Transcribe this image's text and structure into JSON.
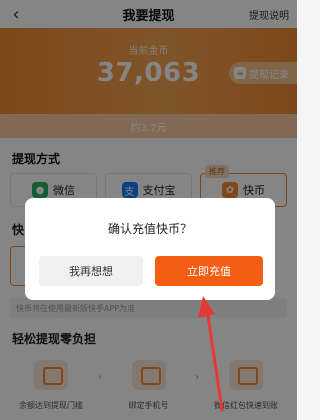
{
  "header": {
    "title": "我要提现",
    "right_link": "提现说明"
  },
  "banner": {
    "label": "当前金币",
    "amount": "37,063",
    "record_button": "提现记录",
    "approx": "约3.7元"
  },
  "methods": {
    "title": "提现方式",
    "items": [
      {
        "label": "微信",
        "icon": "wechat-icon"
      },
      {
        "label": "支付宝",
        "icon": "alipay-icon"
      },
      {
        "label": "快币",
        "icon": "kuaibi-icon",
        "tag": "推荐"
      }
    ]
  },
  "kuaibi_section": {
    "title_visible": "快"
  },
  "note": "快币将在使用最新版快手APP为准",
  "easy": {
    "title": "轻松提现零负担",
    "steps": [
      "余额达到提现门槛",
      "绑定手机号",
      "微信红包快速到账"
    ]
  },
  "dialog": {
    "message": "确认充值快币？",
    "cancel": "我再想想",
    "confirm": "立即充值"
  },
  "colors": {
    "accent": "#f45d14",
    "banner": "#f28a37",
    "arrow": "#e53935"
  }
}
